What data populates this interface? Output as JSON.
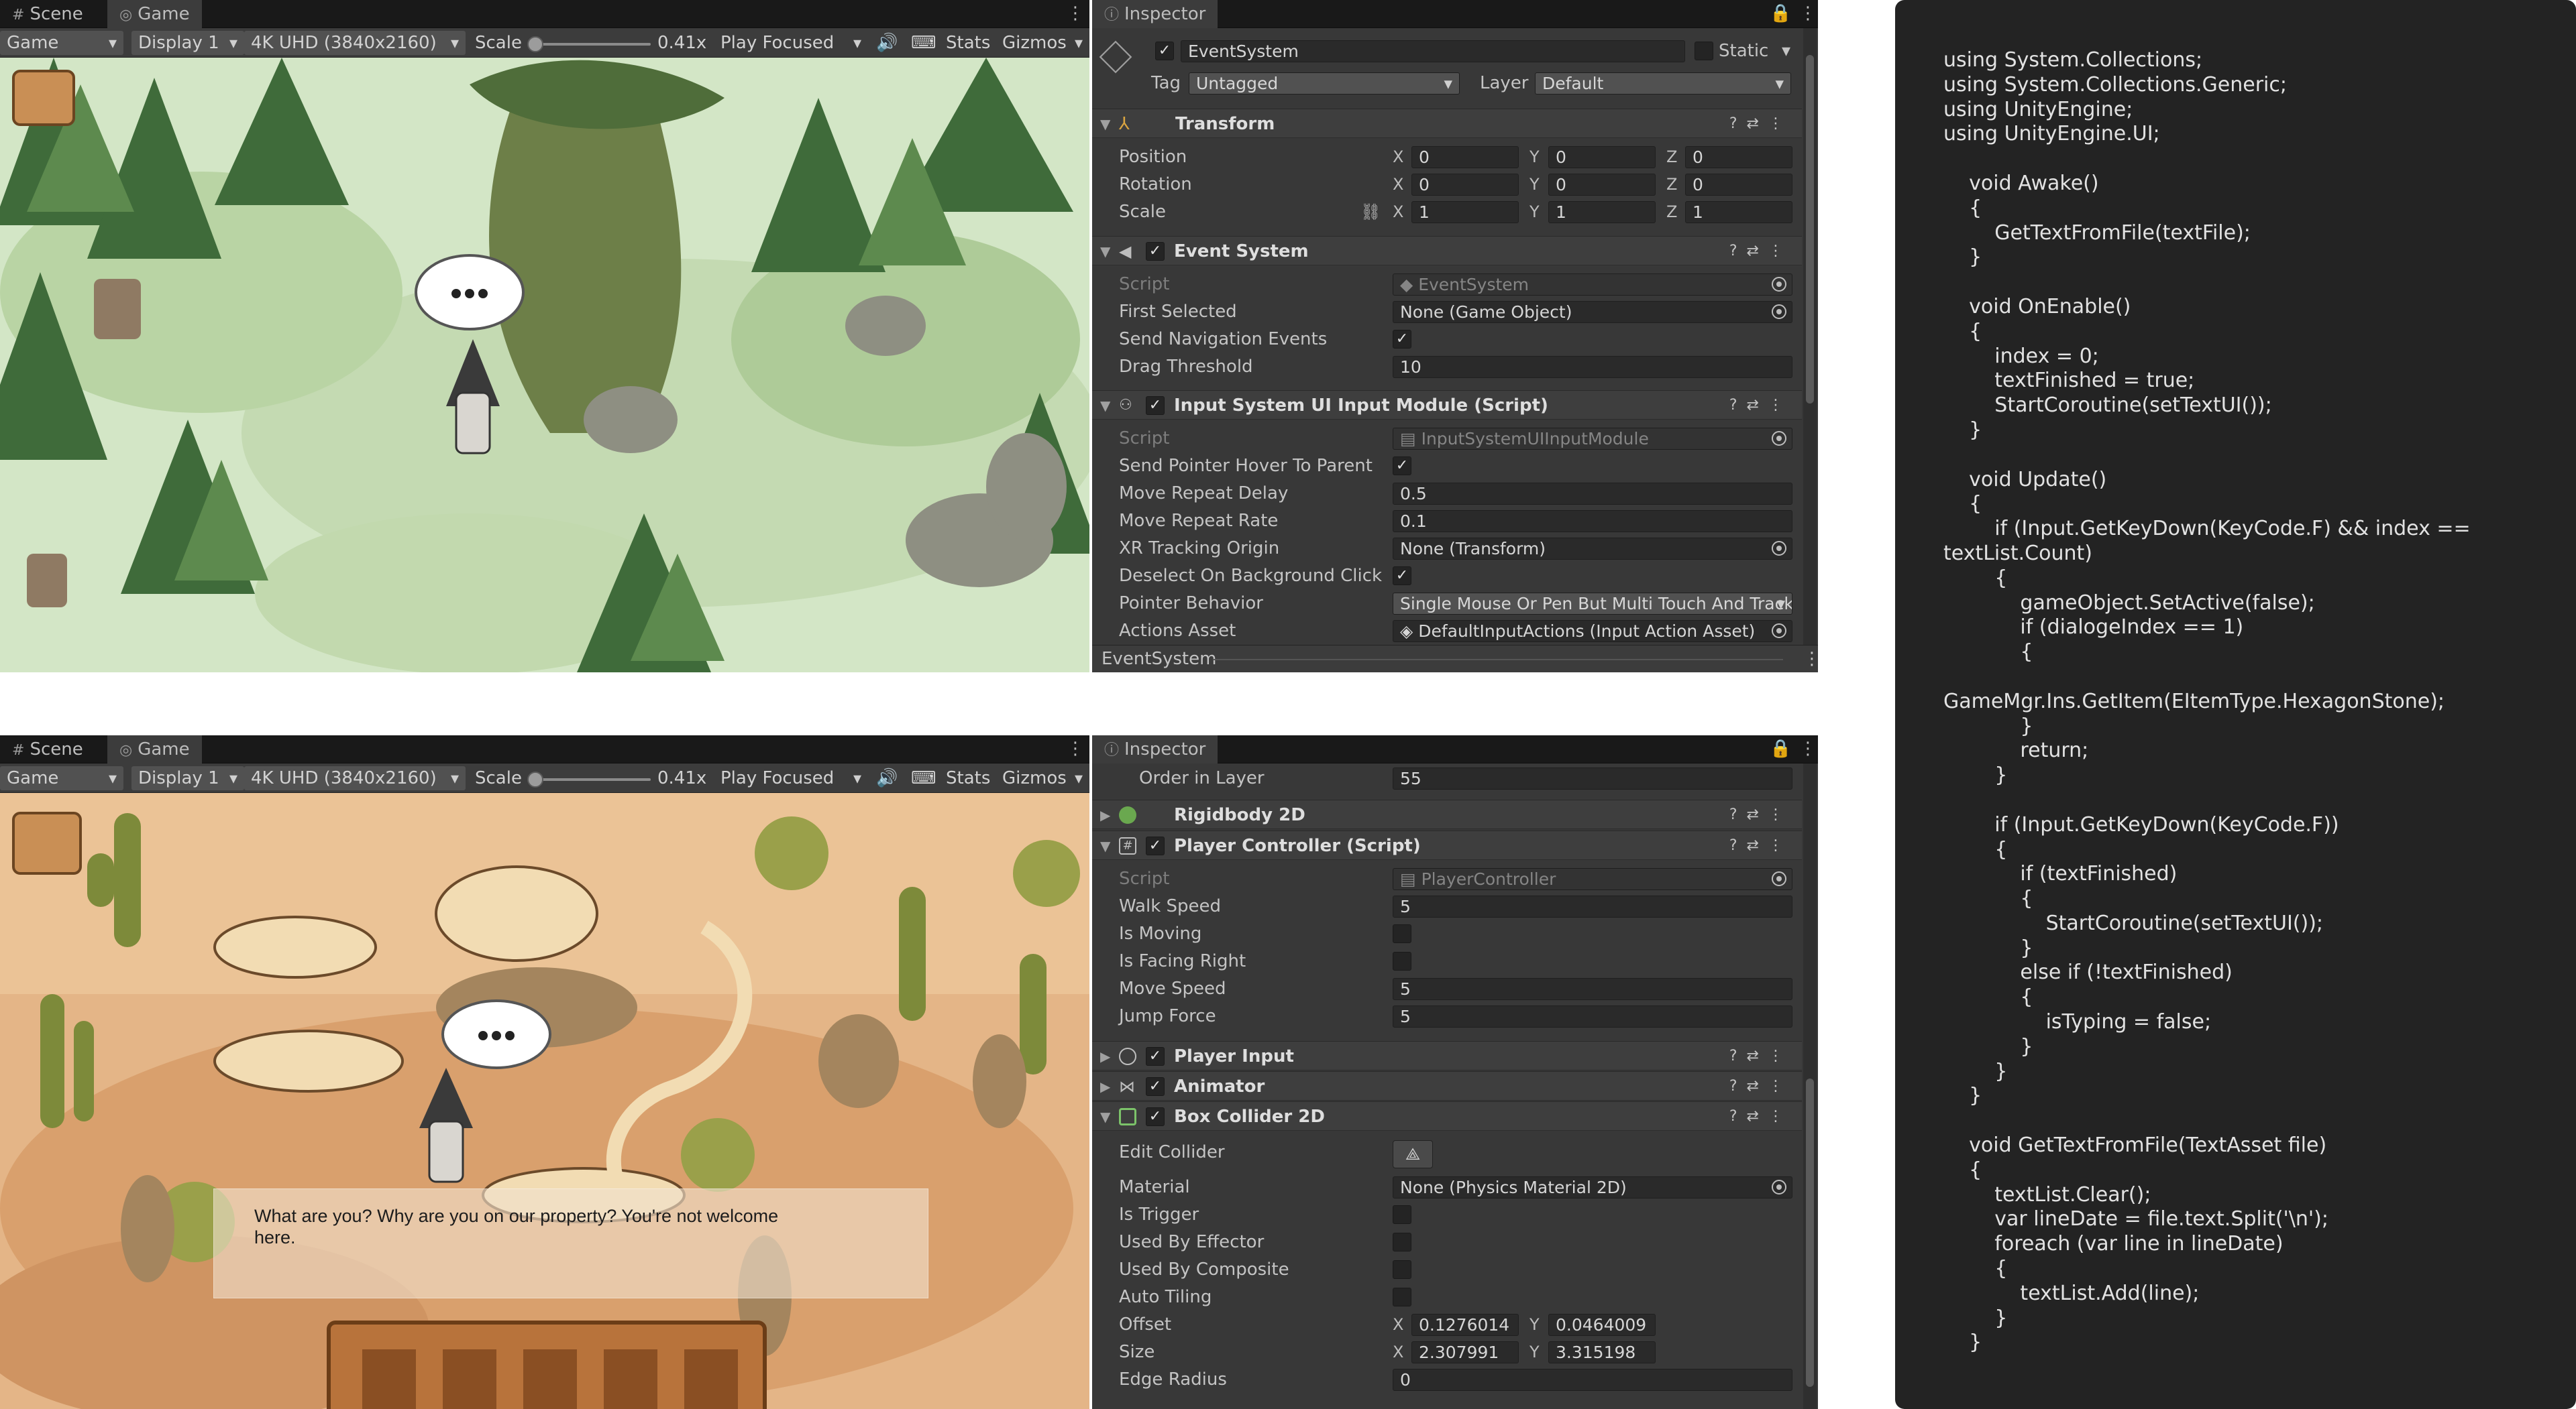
{
  "top": {
    "tabs": {
      "scene": "Scene",
      "game": "Game"
    },
    "toolbar": {
      "mode": "Game",
      "display": "Display 1",
      "resolution": "4K UHD (3840x2160)",
      "scale_label": "Scale",
      "scale_value": "0.41x",
      "play": "Play Focused",
      "stats": "Stats",
      "gizmos": "Gizmos"
    },
    "inspector": {
      "tab": "Inspector",
      "object_name": "EventSystem",
      "static_label": "Static",
      "tag_label": "Tag",
      "tag_value": "Untagged",
      "layer_label": "Layer",
      "layer_value": "Default",
      "transform": {
        "title": "Transform",
        "rows": [
          {
            "label": "Position",
            "x": "0",
            "y": "0",
            "z": "0"
          },
          {
            "label": "Rotation",
            "x": "0",
            "y": "0",
            "z": "0"
          },
          {
            "label": "Scale",
            "x": "1",
            "y": "1",
            "z": "1"
          }
        ]
      },
      "event_system": {
        "title": "Event System",
        "script_label": "Script",
        "script_value": "EventSystem",
        "first_selected_label": "First Selected",
        "first_selected_value": "None (Game Object)",
        "send_nav_label": "Send Navigation Events",
        "drag_label": "Drag Threshold",
        "drag_value": "10"
      },
      "input_module": {
        "title": "Input System UI Input Module (Script)",
        "script_label": "Script",
        "script_value": "InputSystemUIInputModule",
        "hover_label": "Send Pointer Hover To Parent",
        "delay_label": "Move Repeat Delay",
        "delay_value": "0.5",
        "rate_label": "Move Repeat Rate",
        "rate_value": "0.1",
        "xr_label": "XR Tracking Origin",
        "xr_value": "None (Transform)",
        "deselect_label": "Deselect On Background Click",
        "pointer_label": "Pointer Behavior",
        "pointer_value": "Single Mouse Or Pen But Multi Touch And Track",
        "actions_label": "Actions Asset",
        "actions_value": "DefaultInputActions (Input Action Asset)"
      },
      "footer": "EventSystem"
    }
  },
  "bottom": {
    "tabs": {
      "scene": "Scene",
      "game": "Game"
    },
    "toolbar": {
      "mode": "Game",
      "display": "Display 1",
      "resolution": "4K UHD (3840x2160)",
      "scale_label": "Scale",
      "scale_value": "0.41x",
      "play": "Play Focused",
      "stats": "Stats",
      "gizmos": "Gizmos"
    },
    "dialogue": "What are you? Why are you on our property? You're not welcome here.",
    "inspector": {
      "tab": "Inspector",
      "order_label": "Order in Layer",
      "order_value": "55",
      "rigidbody": "Rigidbody 2D",
      "player_controller": {
        "title": "Player Controller (Script)",
        "script_label": "Script",
        "script_value": "PlayerController",
        "walk_label": "Walk Speed",
        "walk_value": "5",
        "moving_label": "Is Moving",
        "facing_label": "Is Facing Right",
        "move_label": "Move Speed",
        "move_value": "5",
        "jump_label": "Jump Force",
        "jump_value": "5"
      },
      "player_input": "Player Input",
      "animator": "Animator",
      "box_collider": {
        "title": "Box Collider 2D",
        "edit_label": "Edit Collider",
        "material_label": "Material",
        "material_value": "None (Physics Material 2D)",
        "trigger_label": "Is Trigger",
        "effector_label": "Used By Effector",
        "composite_label": "Used By Composite",
        "tiling_label": "Auto Tiling",
        "offset_label": "Offset",
        "offset_x": "0.1276014",
        "offset_y": "0.0464009",
        "size_label": "Size",
        "size_x": "2.307991",
        "size_y": "3.315198",
        "edge_label": "Edge Radius",
        "edge_value": "0"
      }
    }
  },
  "code": {
    "text": "using System.Collections;\nusing System.Collections.Generic;\nusing UnityEngine;\nusing UnityEngine.UI;\n\n    void Awake()\n    {\n        GetTextFromFile(textFile);\n    }\n\n    void OnEnable()\n    {\n        index = 0;\n        textFinished = true;\n        StartCoroutine(setTextUI());\n    }\n\n    void Update()\n    {\n        if (Input.GetKeyDown(KeyCode.F) && index ==\ntextList.Count)\n        {\n            gameObject.SetActive(false);\n            if (dialogeIndex == 1)\n            {\n\nGameMgr.Ins.GetItem(EItemType.HexagonStone);\n            }\n            return;\n        }\n\n        if (Input.GetKeyDown(KeyCode.F))\n        {\n            if (textFinished)\n            {\n                StartCoroutine(setTextUI());\n            }\n            else if (!textFinished)\n            {\n                isTyping = false;\n            }\n        }\n    }\n\n    void GetTextFromFile(TextAsset file)\n    {\n        textList.Clear();\n        var lineDate = file.text.Split('\\n');\n        foreach (var line in lineDate)\n        {\n            textList.Add(line);\n        }\n    }"
  },
  "colors": {
    "forest_bg": "#cfe3c1",
    "desert_bg": "#e8b98b",
    "inspector_bg": "#383838",
    "code_bg": "#232323"
  }
}
